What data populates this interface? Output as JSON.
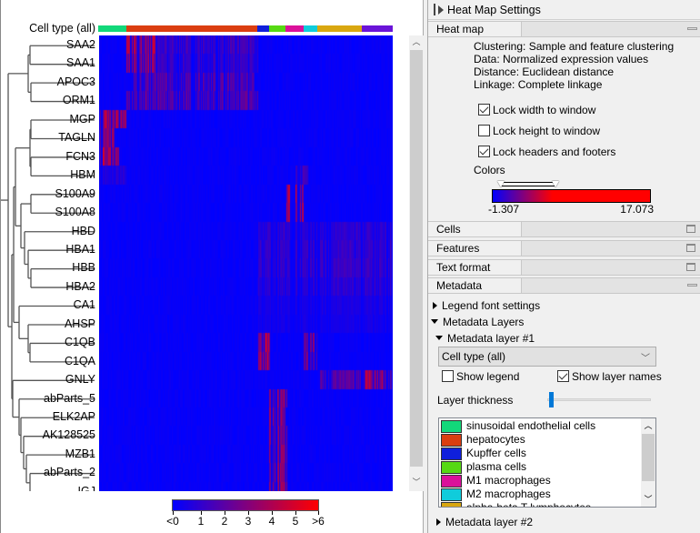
{
  "heatmap": {
    "column_layer_label": "Cell type (all)",
    "genes": [
      "SAA2",
      "SAA1",
      "APOC3",
      "ORM1",
      "MGP",
      "TAGLN",
      "FCN3",
      "HBM",
      "S100A9",
      "S100A8",
      "HBD",
      "HBA1",
      "HBB",
      "HBA2",
      "CA1",
      "AHSP",
      "C1QB",
      "C1QA",
      "GNLY",
      "abParts_5",
      "ELK2AP",
      "AK128525",
      "MZB1",
      "abParts_2",
      "IGJ"
    ],
    "cell_type_bar": [
      {
        "type": "sinusoidal endothelial cells",
        "color": "#12d87a"
      },
      {
        "type": "hepatocytes",
        "color": "#db3e10"
      },
      {
        "type": "Kupffer cells",
        "color": "#0f1fdb"
      },
      {
        "type": "plasma cells",
        "color": "#56d913"
      },
      {
        "type": "M1 macrophages",
        "color": "#db109a"
      },
      {
        "type": "M2 macrophages",
        "color": "#10ccdb"
      },
      {
        "type": "alpha-beta T lymphocytes",
        "color": "#d9a710"
      },
      {
        "type": "",
        "color": "#6a14d8"
      }
    ],
    "color_legend": {
      "ticks": [
        "<0",
        "1",
        "2",
        "3",
        "4",
        "5",
        ">6"
      ],
      "low_color": "#0000ff",
      "high_color": "#ff0000"
    }
  },
  "settings": {
    "title": "Heat Map Settings",
    "heatmap_section": {
      "label": "Heat map",
      "info": [
        "Clustering: Sample and feature clustering",
        "Data: Normalized expression values",
        "Distance: Euclidean distance",
        "Linkage: Complete linkage"
      ],
      "lock_width": {
        "label": "Lock width to window",
        "checked": true
      },
      "lock_height": {
        "label": "Lock height to window",
        "checked": false
      },
      "lock_headers": {
        "label": "Lock headers and footers",
        "checked": true
      },
      "colors_label": "Colors",
      "color_min": "-1.307",
      "color_max": "17.073"
    },
    "sections": [
      "Cells",
      "Features",
      "Text format"
    ],
    "metadata": {
      "label": "Metadata",
      "legend_font": "Legend font settings",
      "layers_label": "Metadata Layers",
      "layer1_label": "Metadata layer #1",
      "layer1_select": "Cell type (all)",
      "show_legend": {
        "label": "Show legend",
        "checked": false
      },
      "show_layer_names": {
        "label": "Show layer names",
        "checked": true
      },
      "thickness_label": "Layer thickness",
      "thickness_value": 0.03,
      "legend_items": [
        {
          "label": "sinusoidal endothelial cells",
          "color": "#12d87a"
        },
        {
          "label": "hepatocytes",
          "color": "#db3e10"
        },
        {
          "label": "Kupffer cells",
          "color": "#0f1fdb"
        },
        {
          "label": "plasma cells",
          "color": "#56d913"
        },
        {
          "label": "M1 macrophages",
          "color": "#db109a"
        },
        {
          "label": "M2 macrophages",
          "color": "#10ccdb"
        },
        {
          "label": "alpha-beta T lymphocytes",
          "color": "#d9a710"
        }
      ],
      "layer2_label": "Metadata layer #2"
    }
  }
}
